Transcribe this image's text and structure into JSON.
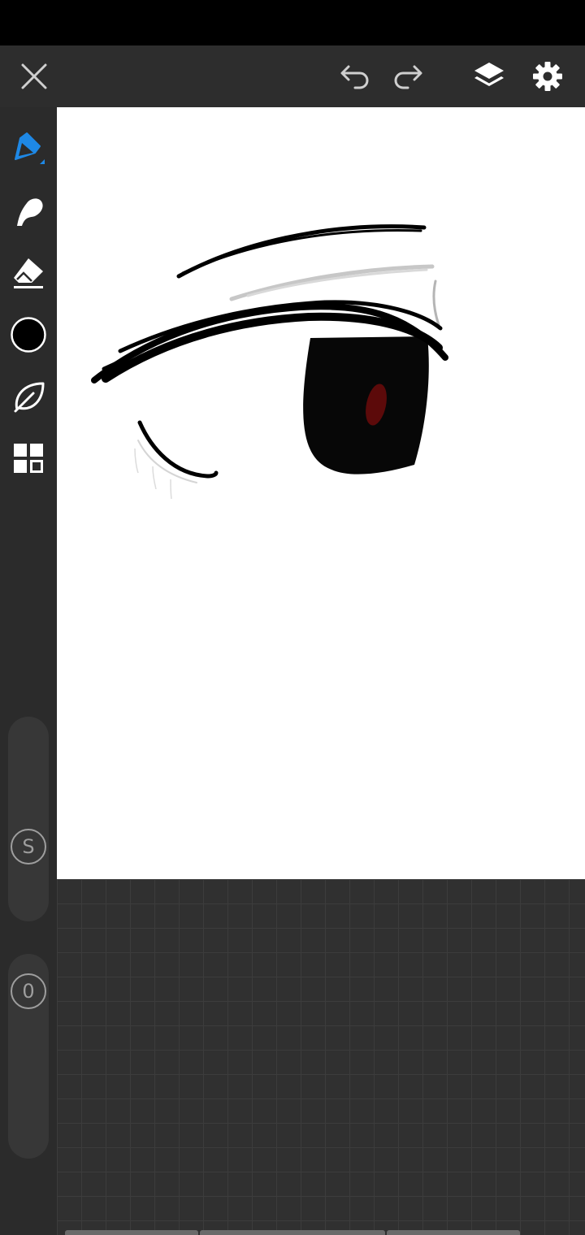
{
  "colors": {
    "status_bar": "#000000",
    "top_bar": "#2d2d2d",
    "rail": "#2b2b2b",
    "accent": "#1e88e5",
    "current_color": "#000000",
    "canvas": "#ffffff",
    "workspace": "#303030"
  },
  "toolbar": {
    "close_icon": "close-icon",
    "undo_icon": "undo-icon",
    "redo_icon": "redo-icon",
    "layers_icon": "layers-icon",
    "settings_icon": "gear-icon"
  },
  "tools": [
    {
      "name": "pen",
      "icon": "pen-icon",
      "active": true
    },
    {
      "name": "smudge",
      "icon": "smudge-icon",
      "active": false
    },
    {
      "name": "eraser",
      "icon": "eraser-icon",
      "active": false
    },
    {
      "name": "color",
      "icon": "color-swatch-icon",
      "active": false
    },
    {
      "name": "leaf",
      "icon": "leaf-icon",
      "active": false
    },
    {
      "name": "grid",
      "icon": "grid-icon",
      "active": false
    }
  ],
  "sliders": {
    "size": {
      "label": "S"
    },
    "opacity": {
      "label": "0"
    }
  }
}
